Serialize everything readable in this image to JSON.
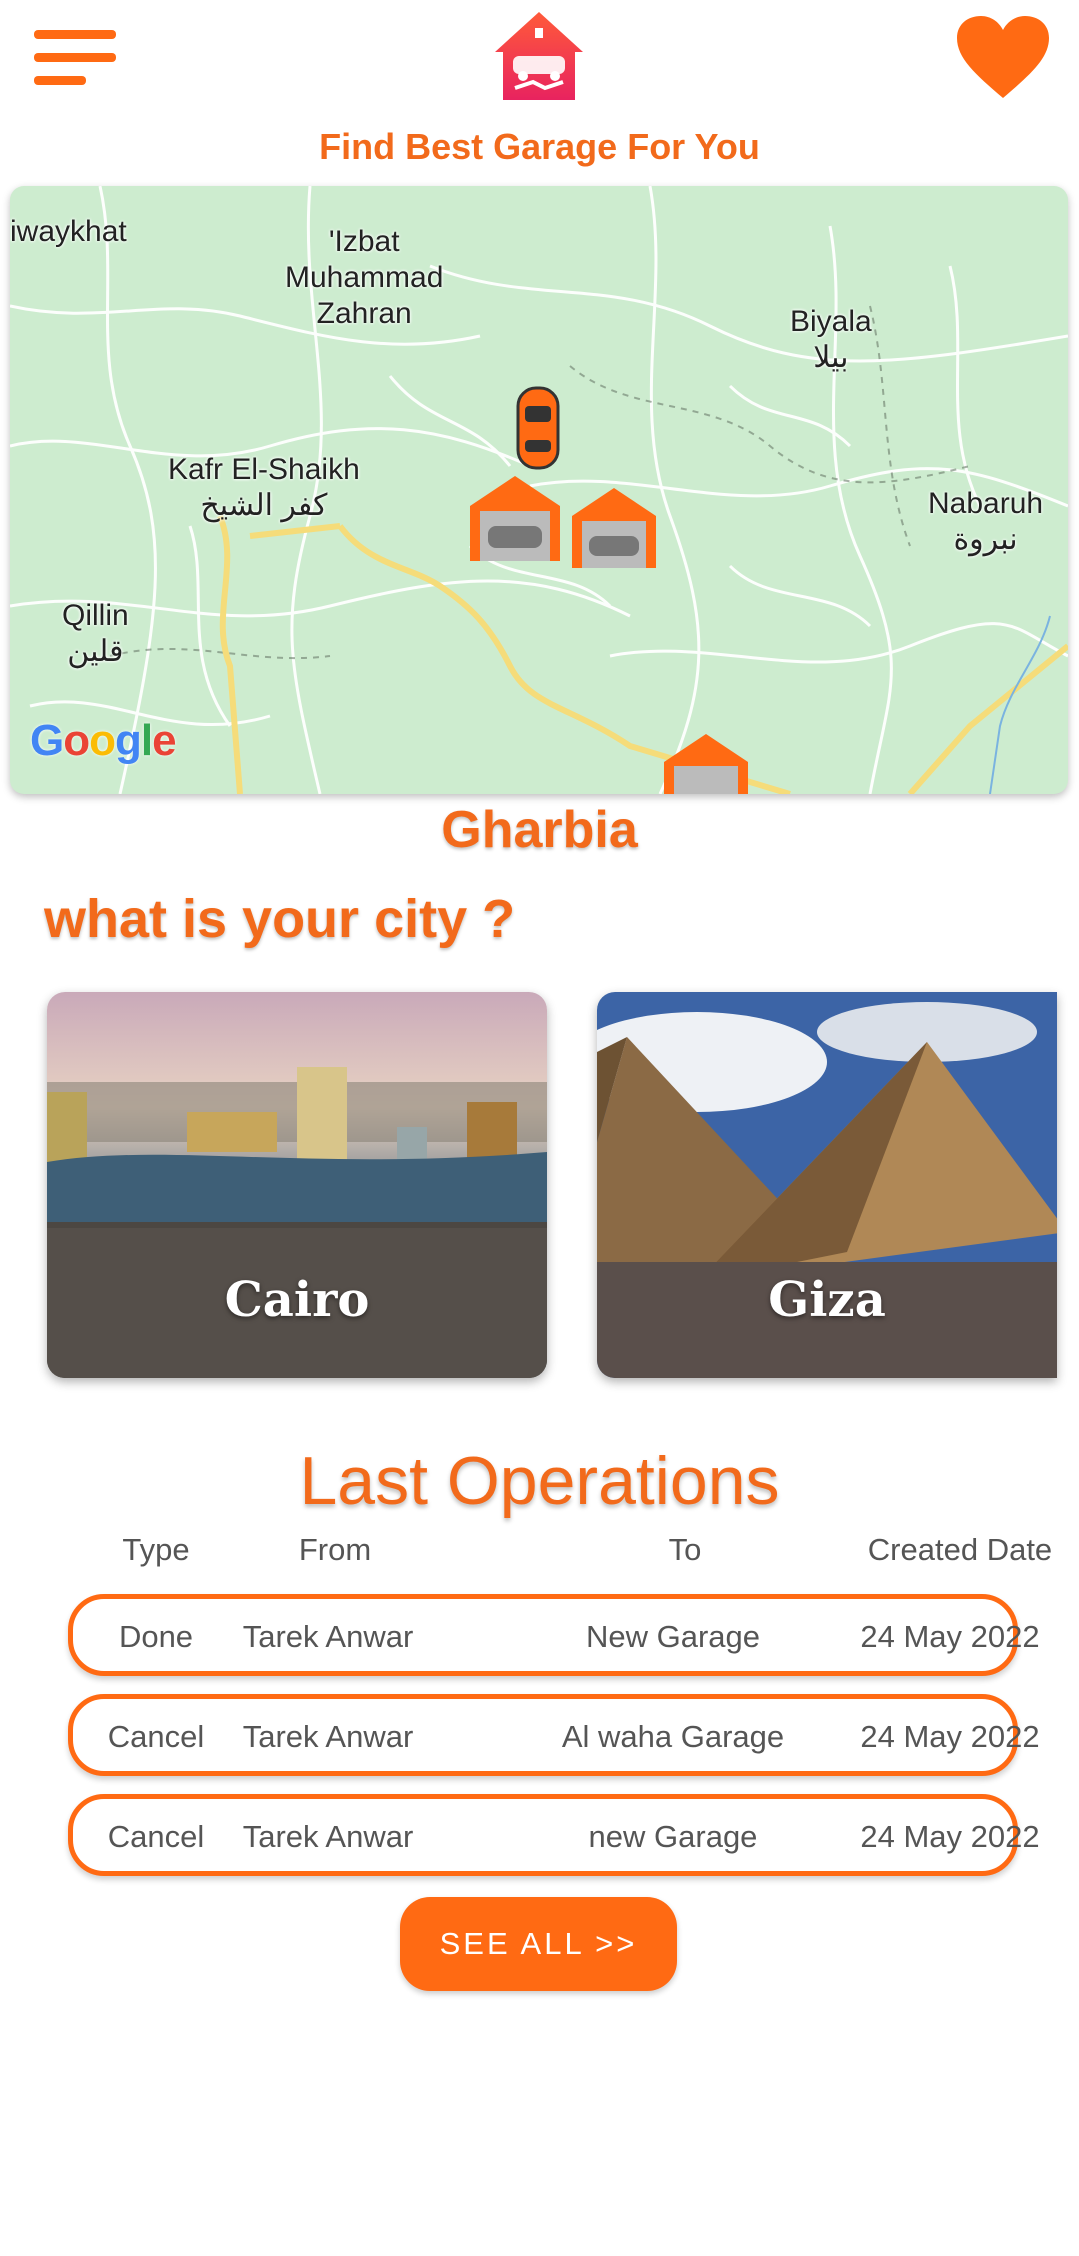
{
  "header": {
    "menu_icon": "hamburger-menu-icon",
    "logo_icon": "garage-house-logo-icon",
    "favorites_icon": "heart-icon",
    "tagline": "Find Best Garage For You"
  },
  "map": {
    "places": [
      {
        "name": "iwaykhat"
      },
      {
        "name": "'Izbat\nMuhammad\nZahran"
      },
      {
        "name": "Biyala\nبيلا"
      },
      {
        "name": "Kafr El-Shaikh\nكفر الشيخ"
      },
      {
        "name": "Nabaruh\nنبروة"
      },
      {
        "name": "Qillin\nقلين"
      }
    ],
    "attribution": "Google",
    "markers": [
      "car-marker-icon",
      "garage-marker-icon",
      "garage-marker-icon",
      "garage-marker-icon"
    ]
  },
  "region": "Gharbia",
  "city_question": "what is your city ?",
  "cities": [
    {
      "name": "Cairo"
    },
    {
      "name": "Giza"
    }
  ],
  "operations": {
    "title": "Last Operations",
    "headers": [
      "Type",
      "From",
      "To",
      "Created Date"
    ],
    "rows": [
      {
        "type": "Done",
        "from": "Tarek Anwar",
        "to": "New Garage",
        "date": "24 May 2022"
      },
      {
        "type": "Cancel",
        "from": "Tarek Anwar",
        "to": "Al waha Garage",
        "date": "24 May 2022"
      },
      {
        "type": "Cancel",
        "from": "Tarek Anwar",
        "to": "new Garage",
        "date": "24 May 2022"
      }
    ],
    "see_all_label": "SEE ALL >>"
  },
  "colors": {
    "accent": "#ff6a13",
    "title_orange": "#f26a1b",
    "map_green": "#cdeccf"
  }
}
